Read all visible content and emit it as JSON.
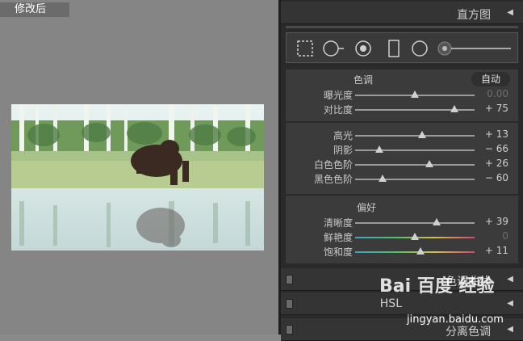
{
  "image_label": "修改后",
  "panel": {
    "histogram_label": "直方图",
    "collapse_icon": "left-triangle-icon",
    "basic": {
      "tone_title": "色调",
      "auto_label": "自动",
      "rows_tone": [
        {
          "label": "曝光度",
          "value": "0.00",
          "fraction": 0.5,
          "dim": true
        },
        {
          "label": "对比度",
          "value": "+ 75",
          "fraction": 0.83,
          "dim": false
        }
      ],
      "rows_light": [
        {
          "label": "高光",
          "value": "+ 13",
          "fraction": 0.56
        },
        {
          "label": "阴影",
          "value": "− 66",
          "fraction": 0.2
        },
        {
          "label": "白色色阶",
          "value": "+ 26",
          "fraction": 0.62
        },
        {
          "label": "黑色色阶",
          "value": "− 60",
          "fraction": 0.23
        }
      ],
      "presence_title": "偏好",
      "rows_presence": [
        {
          "label": "清晰度",
          "value": "+ 39",
          "fraction": 0.68
        },
        {
          "label": "鲜艳度",
          "value": "0",
          "fraction": 0.5,
          "dim": true,
          "gradient": true
        },
        {
          "label": "饱和度",
          "value": "+ 11",
          "fraction": 0.55,
          "gradient": true
        }
      ]
    },
    "tone_curve_label": "色调曲线",
    "hsl_label": "HSL",
    "split_toning_label": "分离色调"
  },
  "watermark": {
    "main": "Bai 百度 经验",
    "url": "jingyan.baidu.com"
  }
}
